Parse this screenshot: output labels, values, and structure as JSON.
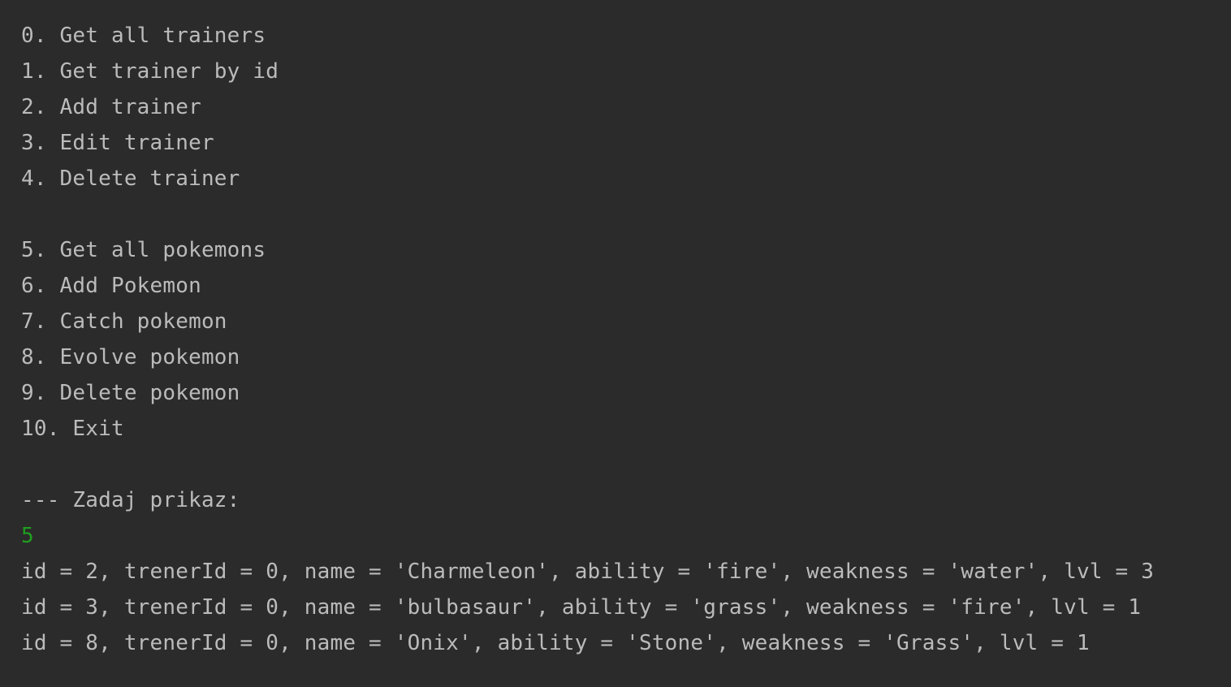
{
  "colors": {
    "background": "#2b2b2b",
    "text": "#bbbbbb",
    "user_input": "#1f9f1f"
  },
  "menu": {
    "trainer_items": [
      "0. Get all trainers",
      "1. Get trainer by id",
      "2. Add trainer",
      "3. Edit trainer",
      "4. Delete trainer"
    ],
    "pokemon_items": [
      "5. Get all pokemons",
      "6. Add Pokemon",
      "7. Catch pokemon",
      "8. Evolve pokemon",
      "9. Delete pokemon",
      "10. Exit"
    ]
  },
  "prompt": {
    "text": "--- Zadaj prikaz:",
    "user_input": "5"
  },
  "output": {
    "lines": [
      "id = 2, trenerId = 0, name = 'Charmeleon', ability = 'fire', weakness = 'water', lvl = 3",
      "id = 3, trenerId = 0, name = 'bulbasaur', ability = 'grass', weakness = 'fire', lvl = 1",
      "id = 8, trenerId = 0, name = 'Onix', ability = 'Stone', weakness = 'Grass', lvl = 1"
    ]
  }
}
